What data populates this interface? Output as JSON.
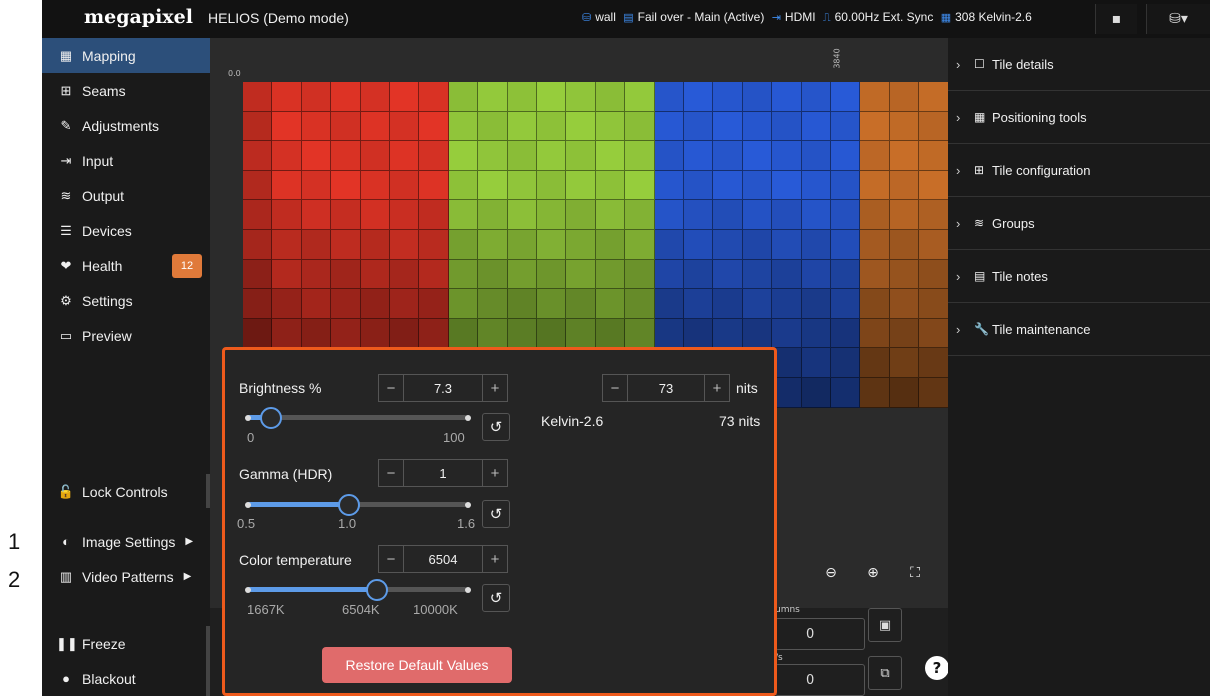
{
  "markers": [
    "1",
    "2"
  ],
  "brand": "megapixel",
  "app_title": "HELIOS (Demo mode)",
  "status": {
    "wall": "wall",
    "failover": "Fail over - Main (Active)",
    "input": "HDMI",
    "sync": "60.00Hz Ext. Sync",
    "tiles": "308 Kelvin-2.6"
  },
  "sidebar": {
    "items": [
      {
        "label": "Mapping",
        "icon": "▦"
      },
      {
        "label": "Seams",
        "icon": "⊞"
      },
      {
        "label": "Adjustments",
        "icon": "✎"
      },
      {
        "label": "Input",
        "icon": "⇥"
      },
      {
        "label": "Output",
        "icon": "≋"
      },
      {
        "label": "Devices",
        "icon": "☰"
      },
      {
        "label": "Health",
        "icon": "❤",
        "badge": "12"
      },
      {
        "label": "Settings",
        "icon": "⚙"
      },
      {
        "label": "Preview",
        "icon": "▭"
      }
    ],
    "lock_controls": "Lock Controls",
    "image_settings": "Image Settings",
    "video_patterns": "Video Patterns",
    "freeze": "Freeze",
    "blackout": "Blackout"
  },
  "canvas": {
    "ruler_start": "0.0",
    "ruler_mark": "3840",
    "bottom_label_columns": "umns",
    "bottom_label_rows": "/s",
    "columns_value": "0",
    "rows_value": "0"
  },
  "right_panel": [
    {
      "label": "Tile details",
      "icon": "☐"
    },
    {
      "label": "Positioning tools",
      "icon": "▦"
    },
    {
      "label": "Tile configuration",
      "icon": "⊞"
    },
    {
      "label": "Groups",
      "icon": "≋"
    },
    {
      "label": "Tile notes",
      "icon": "▤"
    },
    {
      "label": "Tile maintenance",
      "icon": "🔧"
    }
  ],
  "popover": {
    "brightness_label": "Brightness %",
    "brightness_value": "7.3",
    "brightness_min": "0",
    "brightness_max": "100",
    "brightness_fraction": 0.073,
    "nits_value": "73",
    "nits_unit": "nits",
    "tile_type": "Kelvin-2.6",
    "tile_nits": "73 nits",
    "gamma_label": "Gamma (HDR)",
    "gamma_value": "1",
    "gamma_min": "0.5",
    "gamma_mid": "1.0",
    "gamma_max": "1.6",
    "color_temp_label": "Color temperature",
    "color_temp_value": "6504",
    "color_temp_min": "1667K",
    "color_temp_mid": "6504K",
    "color_temp_max": "10000K",
    "restore_label": "Restore Default Values"
  },
  "colors": {
    "accent_blue": "#2c4f7a",
    "popover_border": "#ee5a1c",
    "badge": "#e07a3a",
    "restore": "#e06b6b",
    "slider": "#5d9be8"
  }
}
